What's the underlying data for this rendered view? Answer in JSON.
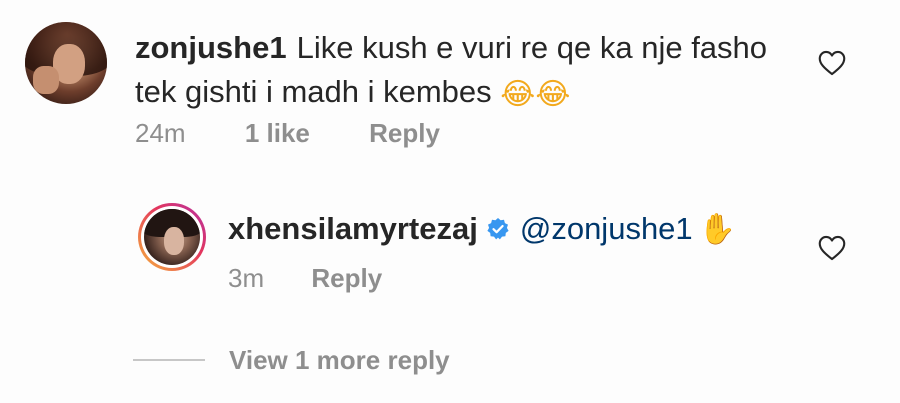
{
  "comment": {
    "username": "zonjushe1",
    "text": "Like kush e vuri re qe ka nje fasho tek gishti i madh i kembes",
    "emoji": "😂😂",
    "time": "24m",
    "likes": "1 like",
    "reply_label": "Reply",
    "like_icon": "heart-outline-icon"
  },
  "reply": {
    "username": "xhensilamyrtezaj",
    "verified_icon": "verified-badge-icon",
    "mention": "@zonjushe1",
    "emoji": "✋",
    "time": "3m",
    "reply_label": "Reply",
    "like_icon": "heart-outline-icon"
  },
  "view_more": {
    "label": "View 1 more reply"
  },
  "colors": {
    "text": "#262626",
    "secondary": "#8e8e8e",
    "verified": "#3897f0",
    "mention": "#00376b"
  }
}
